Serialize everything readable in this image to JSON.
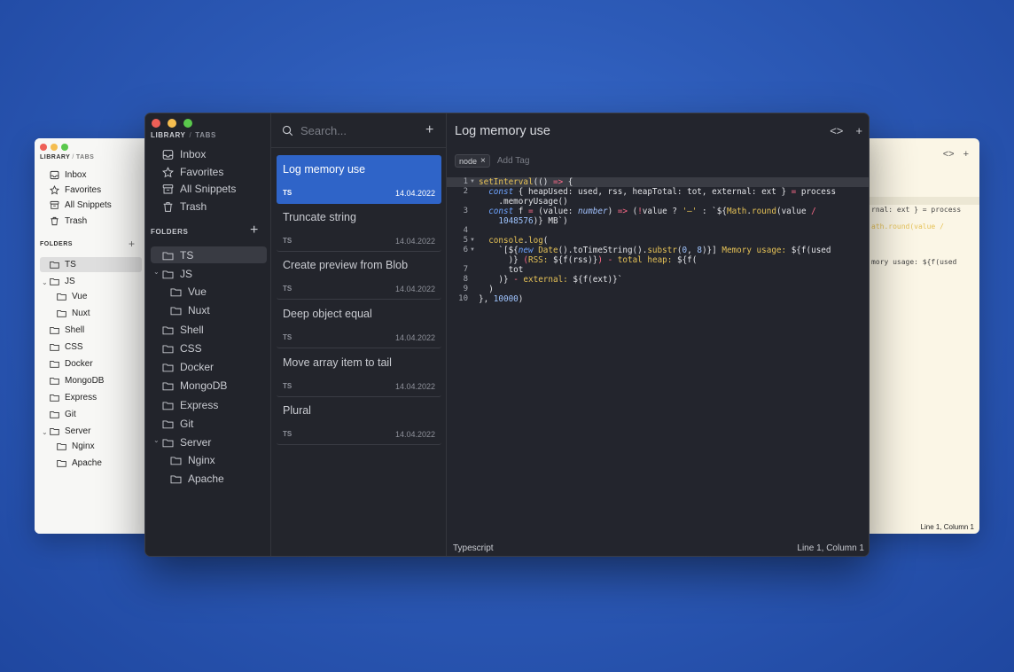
{
  "back_window": {
    "library_label": "LIBRARY",
    "separator": "/",
    "tabs_label": "TABS",
    "nav": [
      "Inbox",
      "Favorites",
      "All Snippets",
      "Trash"
    ],
    "folders_label": "FOLDERS",
    "folders": [
      "TS",
      "JS",
      "Vue",
      "Nuxt",
      "Shell",
      "CSS",
      "Docker",
      "MongoDB",
      "Express",
      "Git",
      "Server",
      "Nginx",
      "Apache"
    ],
    "status_right": "Line 1, Column 1",
    "code_fragments": [
      "rnal: ext } = process",
      "ath.round(value /",
      "mory usage: ${f(used"
    ]
  },
  "window": {
    "library_label": "LIBRARY",
    "separator": "/",
    "tabs_label": "TABS",
    "nav": {
      "inbox": "Inbox",
      "favorites": "Favorites",
      "all_snippets": "All Snippets",
      "trash": "Trash"
    },
    "folders_label": "FOLDERS",
    "folders": {
      "ts": "TS",
      "js": "JS",
      "vue": "Vue",
      "nuxt": "Nuxt",
      "shell": "Shell",
      "css": "CSS",
      "docker": "Docker",
      "mongodb": "MongoDB",
      "express": "Express",
      "git": "Git",
      "server": "Server",
      "nginx": "Nginx",
      "apache": "Apache"
    }
  },
  "list": {
    "search_placeholder": "Search...",
    "snippets": [
      {
        "title": "Log memory use",
        "lang": "TS",
        "date": "14.04.2022"
      },
      {
        "title": "Truncate string",
        "lang": "TS",
        "date": "14.04.2022"
      },
      {
        "title": "Create preview from Blob",
        "lang": "TS",
        "date": "14.04.2022"
      },
      {
        "title": "Deep object equal",
        "lang": "TS",
        "date": "14.04.2022"
      },
      {
        "title": "Move array item to tail",
        "lang": "TS",
        "date": "14.04.2022"
      },
      {
        "title": "Plural",
        "lang": "TS",
        "date": "14.04.2022"
      }
    ]
  },
  "editor": {
    "title": "Log memory use",
    "tag": "node",
    "add_tag": "Add Tag",
    "line_numbers": [
      "1",
      "2",
      "3",
      "4",
      "5",
      "6",
      "7",
      "8",
      "9",
      "10"
    ],
    "language": "Typescript",
    "cursor": "Line 1, Column 1"
  },
  "icons": {
    "inbox": "inbox-icon",
    "favorites": "star-icon",
    "all_snippets": "archive-icon",
    "trash": "trash-icon",
    "folder": "folder-icon",
    "search": "search-icon",
    "code": "code-icon",
    "plus": "plus-icon"
  },
  "colors": {
    "accent": "#2f64c8",
    "close": "#ee5f57",
    "minimize": "#f5bd4f",
    "maximize": "#5ac84c"
  }
}
